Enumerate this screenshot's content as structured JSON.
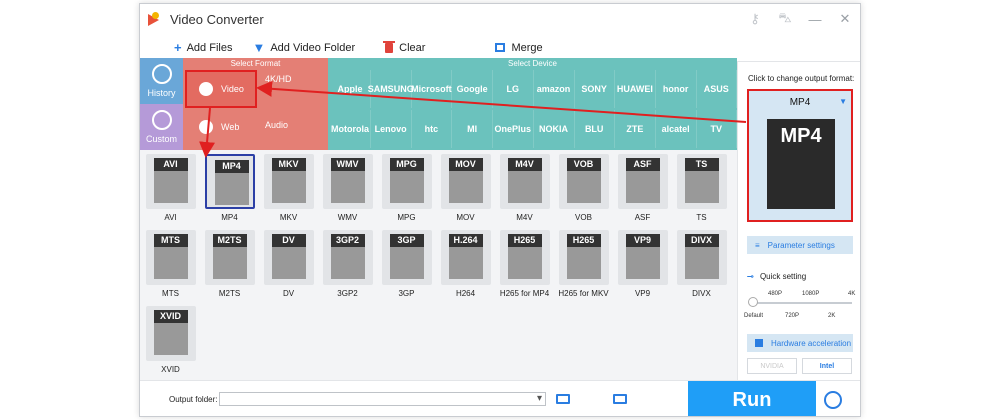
{
  "window": {
    "title": "Video Converter"
  },
  "toolbar": {
    "add_files": "Add Files",
    "add_video_folder": "Add Video Folder",
    "clear": "Clear",
    "merge": "Merge"
  },
  "headers": {
    "select_format": "Select Format",
    "select_device": "Select Device"
  },
  "nav": {
    "history": "History",
    "custom": "Custom"
  },
  "categories": {
    "video": "Video",
    "uhd": "4K/HD",
    "web": "Web",
    "audio": "Audio"
  },
  "devices_row1": [
    "Apple",
    "SAMSUNG",
    "Microsoft",
    "Google",
    "LG",
    "amazon",
    "SONY",
    "HUAWEI",
    "honor",
    "ASUS"
  ],
  "devices_row2": [
    "Motorola",
    "Lenovo",
    "htc",
    "MI",
    "OnePlus",
    "NOKIA",
    "BLU",
    "ZTE",
    "alcatel",
    "TV"
  ],
  "formats": [
    {
      "tag": "AVI",
      "label": "AVI"
    },
    {
      "tag": "MP4",
      "label": "MP4"
    },
    {
      "tag": "MKV",
      "label": "MKV"
    },
    {
      "tag": "WMV",
      "label": "WMV"
    },
    {
      "tag": "MPG",
      "label": "MPG"
    },
    {
      "tag": "MOV",
      "label": "MOV"
    },
    {
      "tag": "M4V",
      "label": "M4V"
    },
    {
      "tag": "VOB",
      "label": "VOB"
    },
    {
      "tag": "ASF",
      "label": "ASF"
    },
    {
      "tag": "TS",
      "label": "TS"
    },
    {
      "tag": "MTS",
      "label": "MTS"
    },
    {
      "tag": "M2TS",
      "label": "M2TS"
    },
    {
      "tag": "DV",
      "label": "DV"
    },
    {
      "tag": "3GP2",
      "label": "3GP2"
    },
    {
      "tag": "3GP",
      "label": "3GP"
    },
    {
      "tag": "H.264",
      "label": "H264"
    },
    {
      "tag": "H265",
      "label": "H265 for MP4"
    },
    {
      "tag": "H265",
      "label": "H265 for MKV"
    },
    {
      "tag": "VP9",
      "label": "VP9"
    },
    {
      "tag": "DIVX",
      "label": "DIVX"
    },
    {
      "tag": "XVID",
      "label": "XVID"
    }
  ],
  "output": {
    "folder_label": "Output folder:",
    "run": "Run"
  },
  "right": {
    "hint": "Click to change output format:",
    "selected_format": "MP4",
    "big_label": "MP4",
    "param": "Parameter settings",
    "quick": "Quick setting",
    "top_ticks": [
      "480P",
      "1080P",
      "4K"
    ],
    "bottom_ticks": [
      "Default",
      "720P",
      "2K"
    ],
    "hw": "Hardware acceleration",
    "nvidia": "NVIDIA",
    "intel": "Intel"
  }
}
